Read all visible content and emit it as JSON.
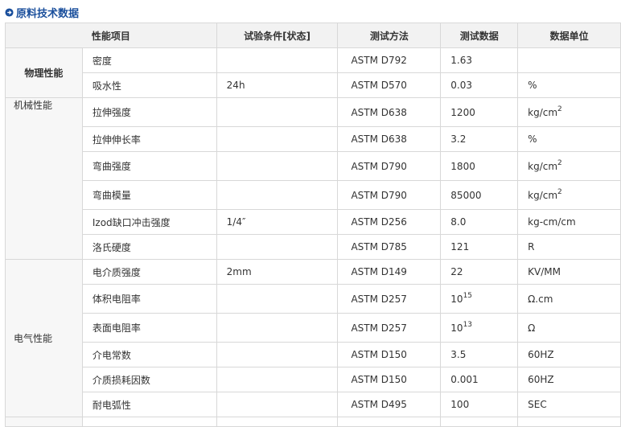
{
  "section_title": "原料技术数据",
  "header": {
    "property": "性能项目",
    "condition": "试验条件[状态]",
    "method": "测试方法",
    "data": "测试数据",
    "unit": "数据单位"
  },
  "groups": [
    {
      "category": "物理性能",
      "rows": [
        {
          "property": "密度",
          "condition": "",
          "method": "ASTM D792",
          "value": "1.63",
          "unit": ""
        },
        {
          "property": "吸水性",
          "condition": "24h",
          "method": "ASTM D570",
          "value": "0.03",
          "unit": "%"
        }
      ]
    },
    {
      "category": "机械性能",
      "rows": [
        {
          "property": "拉伸强度",
          "condition": "",
          "method": "ASTM D638",
          "value": "1200",
          "unit": "kg/cm",
          "unit_sup": "2"
        },
        {
          "property": "拉伸伸长率",
          "condition": "",
          "method": "ASTM D638",
          "value": "3.2",
          "unit": "%"
        },
        {
          "property": "弯曲强度",
          "condition": "",
          "method": "ASTM D790",
          "value": "1800",
          "unit": "kg/cm",
          "unit_sup": "2"
        },
        {
          "property": "弯曲模量",
          "condition": "",
          "method": "ASTM D790",
          "value": "85000",
          "unit": "kg/cm",
          "unit_sup": "2"
        },
        {
          "property": "Izod缺口冲击强度",
          "condition": "1/4″",
          "method": "ASTM D256",
          "value": "8.0",
          "unit": "kg-cm/cm"
        },
        {
          "property": "洛氏硬度",
          "condition": "",
          "method": "ASTM D785",
          "value": "121",
          "unit": "R"
        }
      ]
    },
    {
      "category": "电气性能",
      "rows": [
        {
          "property": "电介质强度",
          "condition": "2mm",
          "method": "ASTM D149",
          "value": "22",
          "unit": "KV/MM"
        },
        {
          "property": "体积电阻率",
          "condition": "",
          "method": "ASTM D257",
          "value": "10",
          "value_sup": "15",
          "unit": "Ω.cm"
        },
        {
          "property": "表面电阻率",
          "condition": "",
          "method": "ASTM D257",
          "value": "10",
          "value_sup": "13",
          "unit": "Ω"
        },
        {
          "property": "介电常数",
          "condition": "",
          "method": "ASTM D150",
          "value": "3.5",
          "unit": "60HZ"
        },
        {
          "property": "介质损耗因数",
          "condition": "",
          "method": "ASTM D150",
          "value": "0.001",
          "unit": "60HZ"
        },
        {
          "property": "耐电弧性",
          "condition": "",
          "method": "ASTM D495",
          "value": "100",
          "unit": "SEC"
        }
      ]
    }
  ],
  "accent_color": "#1a4f9c",
  "icon": "circled-arrow-icon"
}
